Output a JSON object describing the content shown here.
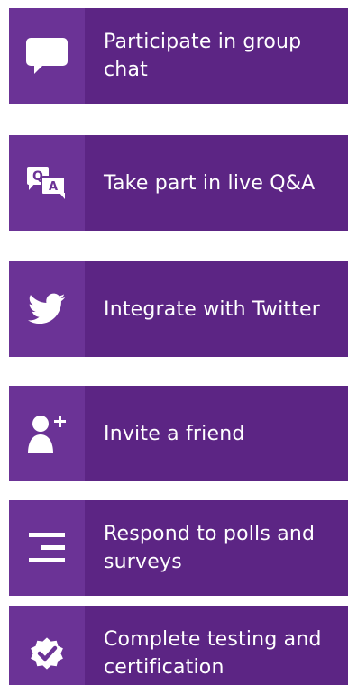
{
  "features": [
    {
      "label": "Participate in group chat",
      "icon": "chat-bubble-icon"
    },
    {
      "label": "Take part in live Q&A",
      "icon": "qa-icon"
    },
    {
      "label": "Integrate with Twitter",
      "icon": "twitter-bird-icon"
    },
    {
      "label": "Invite a friend",
      "icon": "add-user-icon"
    },
    {
      "label": "Respond to polls and surveys",
      "icon": "poll-bars-icon"
    },
    {
      "label": "Complete testing and certification",
      "icon": "certification-badge-icon"
    }
  ],
  "qa_icon_letters": {
    "q": "Q",
    "a": "A"
  },
  "colors": {
    "card_background": "#5c2584",
    "icon_panel_background": "#6b3396",
    "text": "#ffffff"
  }
}
